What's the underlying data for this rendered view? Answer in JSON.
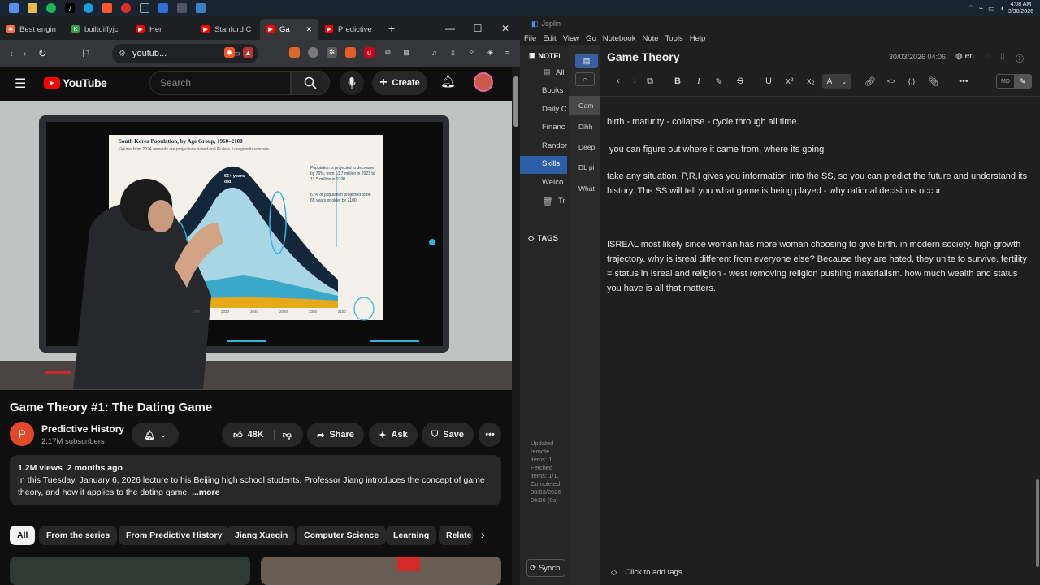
{
  "taskbar": {
    "time": "4:08 AM",
    "date": "3/30/2026",
    "icons": [
      "explorer-icon",
      "files-icon",
      "spotify-icon",
      "tiktok-icon",
      "edge-icon",
      "brave-icon",
      "chrome-icon",
      "steam-icon",
      "app-icon",
      "app2-icon",
      "shield-icon"
    ]
  },
  "browser": {
    "tabs": [
      {
        "label": "Best engin",
        "color": "#ff6a3d",
        "glyph": "✱"
      },
      {
        "label": "builtdiffyjc",
        "color": "#2ea043",
        "glyph": "K"
      },
      {
        "label": "Her",
        "color": "#ff0000",
        "glyph": "▶"
      },
      {
        "label": "Stanford C",
        "color": "#ff0000",
        "glyph": "▶"
      },
      {
        "label": "Ga",
        "color": "#ff0000",
        "glyph": "▶"
      },
      {
        "label": "Predictive",
        "color": "#ff0000",
        "glyph": "▶"
      }
    ],
    "url": "youtub...",
    "new_tab": "+"
  },
  "youtube": {
    "logo": "YouTube",
    "search_placeholder": "Search",
    "create_label": "Create",
    "slide_title": "South Korea Population, by Age Group, 1960–2100",
    "slide_subtitle": "Figures from 2024 onwards are projections based on UN data, Low growth scenario",
    "slide_note1": "Population is projected to decrease by 76%, from 51.7 million in 2023 to 13.5 million in 2100",
    "slide_note2": "61% of population projected to be 65 years or older by 2100",
    "slide_label": "65+ years old",
    "slide_years": [
      "2000",
      "2020",
      "2040",
      "2060",
      "2080",
      "2100"
    ],
    "video_title": "Game Theory #1: The Dating Game",
    "channel_initial": "P",
    "channel_name": "Predictive History",
    "subscribers": "2.17M subscribers",
    "likes": "48K",
    "share_label": "Share",
    "ask_label": "Ask",
    "save_label": "Save",
    "views": "1.2M views",
    "age": "2 months ago",
    "description": "In this Tuesday, January 6, 2026 lecture to his Beijing high school students, Professor Jiang introduces the concept of game theory, and how it applies to the dating game.",
    "more": "...more",
    "chips": [
      "All",
      "From the series",
      "From Predictive History",
      "Jiang Xueqin",
      "Computer Science",
      "Learning",
      "Relate"
    ]
  },
  "joplin": {
    "window_title": "Joplin",
    "menu": [
      "File",
      "Edit",
      "View",
      "Go",
      "Notebook",
      "Note",
      "Tools",
      "Help"
    ],
    "logo": "NOTEB",
    "sidebar_items": [
      "All",
      "Books",
      "Daily C",
      "Financ",
      "Randor",
      "Skills",
      "Welco",
      "Tr"
    ],
    "tags_label": "TAGS",
    "notes": [
      "Gam",
      "Dihh",
      "Deep",
      "DL pi",
      "What"
    ],
    "sync_status": "Updated remote items: 1. Fetched items: 1/1. Completed: 30/03/2026 04:06 (8s)",
    "sync_button": "Synch",
    "note_title": "Game Theory",
    "note_date": "30/03/2026 04:06",
    "language": "en",
    "paragraphs": [
      "birth - maturity - collapse - cycle through all time.",
      " you can figure out where it came from, where its going",
      "take any situation, P,R,I gives you information into the SS, so you can predict the future and understand its history. The SS will tell you what game is being played - why rational decisions occur",
      "ISREAL most likely since woman has more woman choosing to give birth. in modern society. high growth trajectory. why is isreal different from everyone else? Because they are hated, they unite to survive. fertility = status in Isreal  and religion - west removing religion pushing materialism. how much wealth and status you have is all that matters."
    ],
    "add_tags": "Click to add tags..."
  }
}
